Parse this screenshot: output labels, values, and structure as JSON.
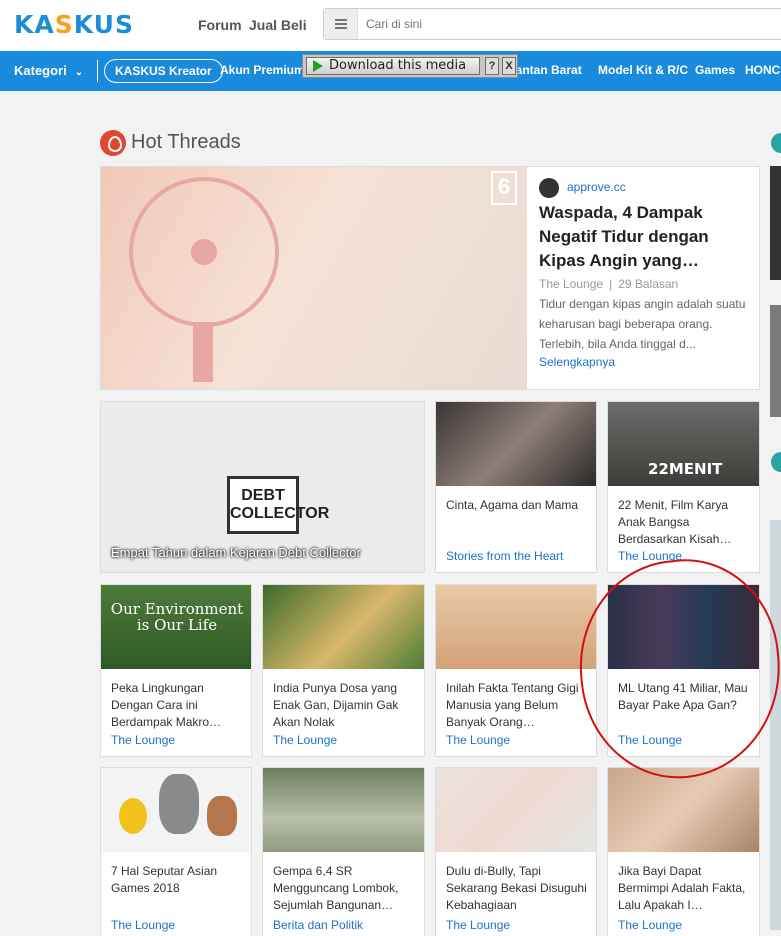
{
  "header": {
    "logo": "KASKUS",
    "nav": [
      "Forum",
      "Jual Beli"
    ],
    "search_placeholder": "Cari di sini"
  },
  "category_bar": {
    "kategori_label": "Kategori",
    "kreator_label": "KASKUS Kreator",
    "items": [
      "Akun Premium",
      "Kalimantan Barat",
      "Model Kit & R/C",
      "Games",
      "HONC"
    ]
  },
  "download_bar": {
    "label": "Download this media",
    "help": "?",
    "close": "X"
  },
  "hot_threads": {
    "title": "Hot Threads",
    "featured": {
      "source": "approve.cc",
      "title": "Waspada, 4 Dampak Negatif Tidur dengan Kipas Angin yang…",
      "category": "The Lounge",
      "replies": "29 Balasan",
      "description": "Tidur dengan kipas angin adalah suatu keharusan bagi beberapa orang. Terlebih, bila Anda tinggal d...",
      "more": "Selengkapnya",
      "watermark": "6"
    },
    "big_card": {
      "title": "Empat Tahun dalam Kejaran Debt Collector",
      "sign_text": "DEBT COLLECTOR"
    },
    "cards": [
      {
        "title": "Cinta, Agama dan Mama",
        "category": "Stories from the Heart"
      },
      {
        "title": "22 Menit, Film Karya Anak Bangsa Berdasarkan Kisah…",
        "category": "The Lounge",
        "thumb_text": "22MENIT"
      },
      {
        "title": "Peka Lingkungan Dengan Cara ini Berdampak Makro…",
        "category": "The Lounge",
        "thumb_text": "Our Environment is Our Life"
      },
      {
        "title": "India Punya Dosa yang Enak Gan, Dijamin Gak Akan Nolak",
        "category": "The Lounge"
      },
      {
        "title": "Inilah Fakta Tentang Gigi Manusia yang Belum Banyak Orang…",
        "category": "The Lounge"
      },
      {
        "title": "ML Utang 41 Miliar, Mau Bayar Pake Apa Gan?",
        "category": "The Lounge"
      },
      {
        "title": "7 Hal Seputar Asian Games 2018",
        "category": "The Lounge"
      },
      {
        "title": "Gempa 6,4 SR Mengguncang Lombok, Sejumlah Bangunan…",
        "category": "Berita dan Politik"
      },
      {
        "title": "Dulu di-Bully, Tapi Sekarang Bekasi Disuguhi Kebahagiaan",
        "category": "The Lounge"
      },
      {
        "title": "Jika Bayi Dapat Bermimpi Adalah Fakta, Lalu Apakah I…",
        "category": "The Lounge"
      }
    ]
  },
  "colors": {
    "brand_blue": "#1a8bdc",
    "brand_orange": "#f8a11c",
    "link": "#1a73c9",
    "annotation_red": "#d21010"
  }
}
